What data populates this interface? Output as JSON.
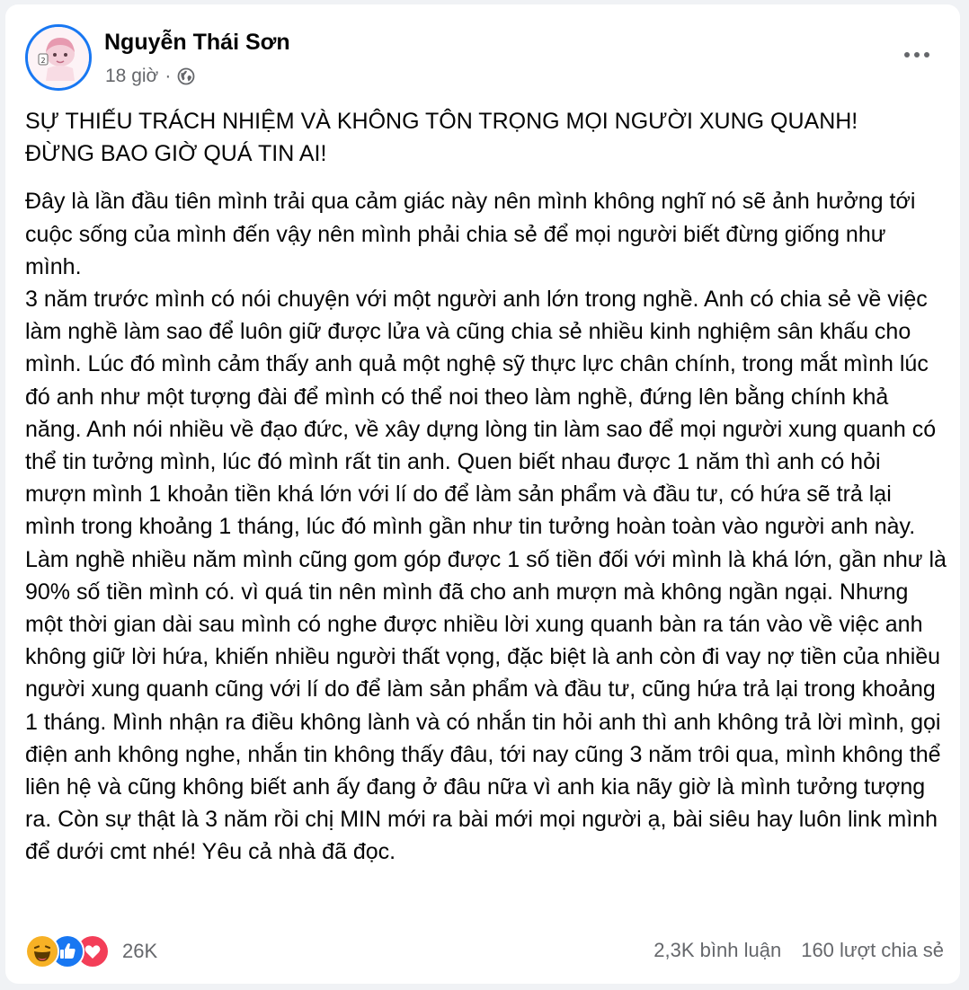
{
  "post": {
    "author": "Nguyễn Thái Sơn",
    "time": "18 giờ",
    "separator": "·",
    "audience_icon": "globe-icon",
    "headline": "SỰ THIẾU TRÁCH NHIỆM VÀ KHÔNG TÔN TRỌNG MỌI NGƯỜI XUNG QUANH!\nĐỪNG BAO GIỜ QUÁ TIN AI!",
    "body": "Đây là lần đầu tiên mình trải qua cảm giác này nên mình không nghĩ nó sẽ ảnh hưởng tới cuộc sống của mình đến vậy nên mình phải chia sẻ để mọi người biết đừng giống như mình.\n3 năm trước mình có nói chuyện với một người anh lớn trong nghề. Anh có chia sẻ về việc làm nghề làm sao để luôn giữ được lửa và cũng chia sẻ nhiều kinh nghiệm sân khấu cho mình. Lúc đó mình cảm thấy anh quả một nghệ sỹ thực lực chân chính, trong mắt mình lúc đó anh như một tượng đài để mình có thể noi theo làm nghề, đứng lên bằng chính khả năng. Anh nói nhiều về đạo đức, về xây dựng lòng tin làm sao để mọi người xung quanh có thể tin tưởng mình, lúc đó mình rất tin anh. Quen biết nhau được 1 năm thì anh có hỏi mượn mình 1 khoản tiền khá lớn với lí do để làm sản phẩm và đầu tư, có hứa sẽ trả lại mình trong khoảng 1 tháng, lúc đó mình gần như tin tưởng hoàn toàn vào người anh này. Làm nghề nhiều năm mình cũng gom góp được 1 số tiền đối với mình là khá lớn, gần như là 90% số tiền mình có. vì quá tin nên mình đã cho anh mượn mà không ngần ngại. Nhưng một thời gian dài sau mình có nghe được nhiều lời xung quanh bàn ra tán vào về việc anh không giữ lời hứa, khiến nhiều người thất vọng, đặc biệt là anh còn đi vay nợ tiền của nhiều người xung quanh cũng với lí do để làm sản phẩm và đầu tư, cũng hứa trả lại trong khoảng 1 tháng. Mình nhận ra điều không lành và có nhắn tin hỏi anh thì anh không trả lời mình, gọi điện anh không nghe, nhắn tin không thấy đâu, tới nay cũng 3 năm trôi qua, mình không thể liên hệ và cũng không biết anh ấy đang ở đâu nữa vì anh kia nãy giờ là mình tưởng tượng ra. Còn sự thật là 3 năm rồi chị MIN mới ra bài mới mọi người ạ, bài siêu hay luôn link mình để dưới cmt nhé! Yêu cả nhà đã đọc."
  },
  "footer": {
    "reaction_icons": [
      "haha-icon",
      "like-icon",
      "love-icon"
    ],
    "reaction_count": "26K",
    "comments": "2,3K bình luận",
    "shares": "160 lượt chia sẻ"
  },
  "colors": {
    "accent": "#1877f2",
    "love": "#f33e58",
    "haha": "#f7b125",
    "secondary_text": "#65676b"
  }
}
